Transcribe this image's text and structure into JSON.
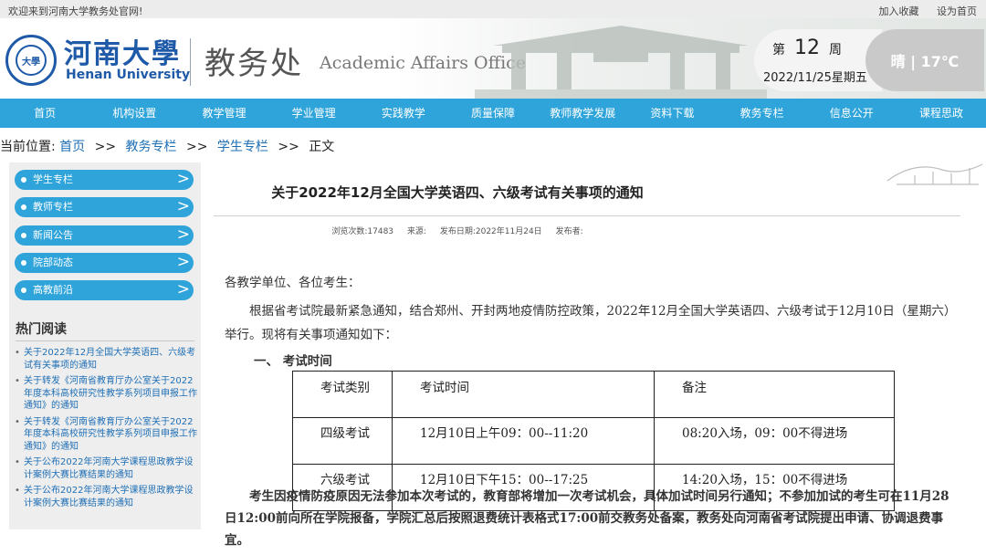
{
  "topbar": {
    "welcome": "欢迎来到河南大学教务处官网!",
    "add_favorite": "加入收藏",
    "set_homepage": "设为首页"
  },
  "header": {
    "university_cn": "河南大學",
    "university_en": "Henan University",
    "seal_text": "大學",
    "department_cn": "教务处",
    "department_en": "Academic Affairs Office",
    "week_prefix": "第",
    "week_number": "12",
    "week_suffix": "周",
    "date": "2022/11/25星期五",
    "weather": "晴 | 17℃"
  },
  "nav": {
    "items": [
      "首页",
      "机构设置",
      "教学管理",
      "学业管理",
      "实践教学",
      "质量保障",
      "教师教学发展",
      "资料下载",
      "教务专栏",
      "信息公开",
      "课程思政"
    ]
  },
  "breadcrumb": {
    "prefix": "当前位置:",
    "home": "首页",
    "sep": ">>",
    "level1": "教务专栏",
    "level2": "学生专栏",
    "current": "正文"
  },
  "sidebar": {
    "menu": [
      "学生专栏",
      "教师专栏",
      "新闻公告",
      "院部动态",
      "高教前沿"
    ],
    "arrow": ">",
    "hot_title": "热门阅读",
    "hot_items": [
      "关于2022年12月全国大学英语四、六级考试有关事项的通知",
      "关于转发《河南省教育厅办公室关于2022年度本科高校研究性教学系列项目申报工作通知》的通知",
      "关于转发《河南省教育厅办公室关于2022年度本科高校研究性教学系列项目申报工作通知》的通知",
      "关于公布2022年河南大学课程思政教学设计案例大赛比赛结果的通知",
      "关于公布2022年河南大学课程思政教学设计案例大赛比赛结果的通知"
    ]
  },
  "article": {
    "title": "关于2022年12月全国大学英语四、六级考试有关事项的通知",
    "meta": {
      "views": "浏览次数:17483",
      "source": "来源:",
      "published": "发布日期:2022年11月24日",
      "publisher": "发布者:"
    },
    "greeting": "各教学单位、各位考生：",
    "para1": "根据省考试院最新紧急通知，结合郑州、开封两地疫情防控政策，2022年12月全国大学英语四、六级考试于12月10日（星期六）举行。现将有关事项通知如下：",
    "section1": "一、  考试时间",
    "table": {
      "headers": [
        "考试类别",
        "考试时间",
        "备注"
      ],
      "rows": [
        [
          "四级考试",
          "12月10日上午09：00--11:20",
          "08:20入场，09：00不得进场"
        ],
        [
          "六级考试",
          "12月10日下午15：00--17:25",
          "14:20入场，15：00不得进场"
        ]
      ]
    },
    "para2": "考生因疫情防疫原因无法参加本次考试的，教育部将增加一次考试机会，具体加试时间另行通知；不参加加试的考生可在11月28日12:00前向所在学院报备，学院汇总后按照退费统计表格式17:00前交教务处备案，教务处向河南省考试院提出申请、协调退费事宜。"
  },
  "colors": {
    "nav_bg": "#2fa4da",
    "brand_blue": "#1f5aa8",
    "link_blue": "#1f6fb5",
    "sidebar_bg": "#eeeeee"
  }
}
